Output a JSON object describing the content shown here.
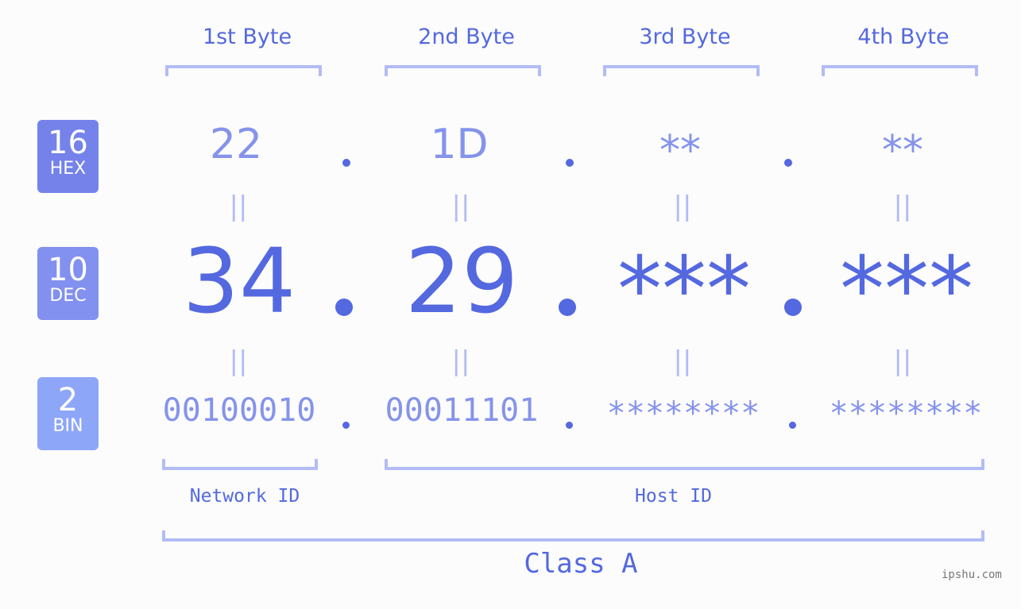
{
  "bytes": [
    {
      "label": "1st Byte",
      "hex": "22",
      "dec": "34",
      "bin": "00100010"
    },
    {
      "label": "2nd Byte",
      "hex": "1D",
      "dec": "29",
      "bin": "00011101"
    },
    {
      "label": "3rd Byte",
      "hex": "**",
      "dec": "***",
      "bin": "********"
    },
    {
      "label": "4th Byte",
      "hex": "**",
      "dec": "***",
      "bin": "********"
    }
  ],
  "badges": {
    "hex": {
      "num": "16",
      "sub": "HEX",
      "color": "#7482ea"
    },
    "dec": {
      "num": "10",
      "sub": "DEC",
      "color": "#8290ef"
    },
    "bin": {
      "num": "2",
      "sub": "BIN",
      "color": "#8ea6f8"
    }
  },
  "equals_symbol": "||",
  "network_id_label": "Network ID",
  "host_id_label": "Host ID",
  "class_label": "Class A",
  "watermark": "ipshu.com",
  "colors": {
    "accent": "#5468e0",
    "light_accent": "#8593eb",
    "bracket": "#b3bcf6",
    "background": "#fbfcfb"
  }
}
